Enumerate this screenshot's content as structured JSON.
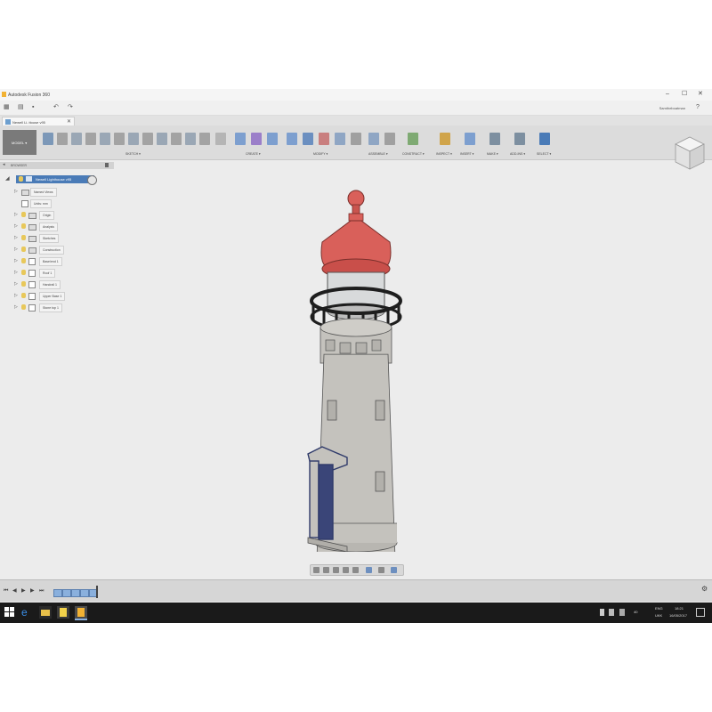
{
  "window": {
    "title": "Autodesk Fusion 360",
    "controls": [
      "–",
      "☐",
      "✕"
    ]
  },
  "quick_access": {
    "user": "Samtheboatman"
  },
  "document_tab": {
    "label": "Newell Li..ttouse v95",
    "close": "✕"
  },
  "toolbar": {
    "workspace": "MODEL ▾",
    "groups": [
      "SKETCH ▾",
      "CREATE ▾",
      "MODIFY ▾",
      "ASSEMBLE ▾",
      "CONSTRUCT ▾",
      "INSPECT ▾",
      "INSERT ▾",
      "MAKE ▾",
      "ADD-INS ▾",
      "SELECT ▾"
    ]
  },
  "browser": {
    "header": "BROWSER",
    "root": "Newell Lighthouse v95",
    "items": [
      {
        "label": "Named Views",
        "type": "folder",
        "bulb": false
      },
      {
        "label": "Units: mm",
        "type": "doc",
        "bulb": false
      },
      {
        "label": "Origin",
        "type": "folder",
        "bulb": true
      },
      {
        "label": "Analysis",
        "type": "folder",
        "bulb": true
      },
      {
        "label": "Sketches",
        "type": "folder",
        "bulb": true
      },
      {
        "label": "Construction",
        "type": "folder",
        "bulb": true
      },
      {
        "label": "Base/end 1",
        "type": "body",
        "bulb": true
      },
      {
        "label": "Roof 1",
        "type": "body",
        "bulb": true
      },
      {
        "label": "Handrail 1",
        "type": "body",
        "bulb": true
      },
      {
        "label": "Upper Base 1",
        "type": "body",
        "bulb": true
      },
      {
        "label": "Stone top 1",
        "type": "body",
        "bulb": true
      }
    ]
  },
  "taskbar": {
    "language": "ENG",
    "region": "UKK",
    "time": "18:21",
    "date": "16/05/2017",
    "volume": "40"
  },
  "colors": {
    "roof": "#d9605a",
    "tower": "#c4c2bd",
    "railing": "#1e1e1e",
    "door_frame": "#2f3a6a",
    "selection": "#4a7bb7"
  }
}
